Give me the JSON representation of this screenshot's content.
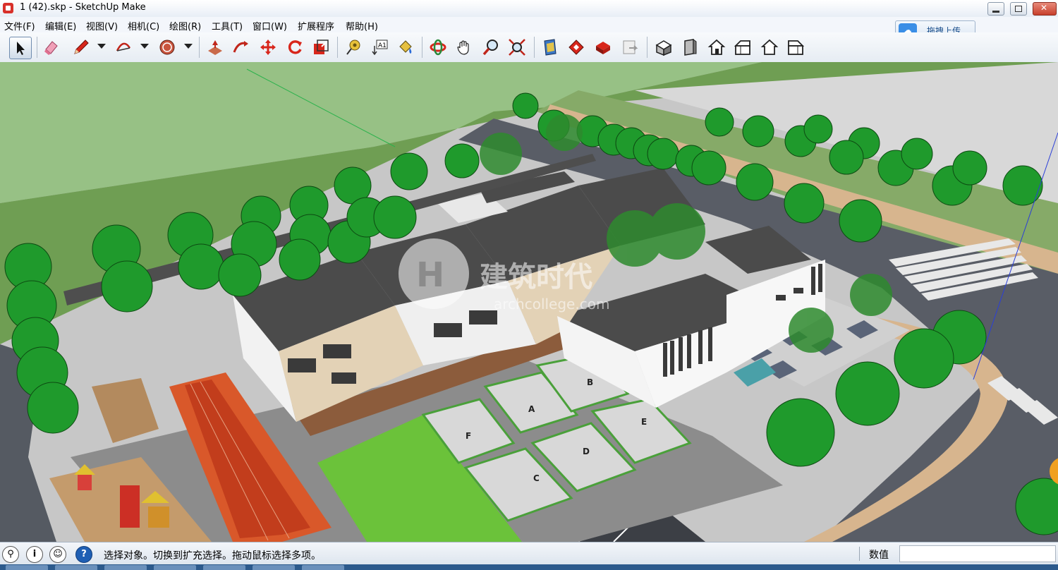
{
  "window": {
    "title": "1 (42).skp - SketchUp Make"
  },
  "menu": {
    "items": [
      "文件(F)",
      "编辑(E)",
      "视图(V)",
      "相机(C)",
      "绘图(R)",
      "工具(T)",
      "窗口(W)",
      "扩展程序",
      "帮助(H)"
    ]
  },
  "upload": {
    "label": "拖拽上传"
  },
  "toolbar": {
    "tools": [
      {
        "name": "select-tool-icon"
      },
      {
        "name": "eraser-tool-icon"
      },
      {
        "name": "pencil-tool-icon"
      },
      {
        "name": "arc-tool-icon"
      },
      {
        "name": "shape-tool-icon"
      },
      {
        "name": "push-pull-tool-icon"
      },
      {
        "name": "follow-me-tool-icon"
      },
      {
        "name": "move-tool-icon"
      },
      {
        "name": "rotate-tool-icon"
      },
      {
        "name": "scale-tool-icon"
      },
      {
        "name": "tape-measure-tool-icon"
      },
      {
        "name": "text-tool-icon"
      },
      {
        "name": "paint-bucket-tool-icon"
      },
      {
        "name": "orbit-tool-icon"
      },
      {
        "name": "pan-tool-icon"
      },
      {
        "name": "zoom-tool-icon"
      },
      {
        "name": "zoom-extents-tool-icon"
      },
      {
        "name": "get-models-icon"
      },
      {
        "name": "share-model-icon"
      },
      {
        "name": "extension-warehouse-icon"
      },
      {
        "name": "send-to-layout-icon"
      },
      {
        "name": "iso-view-icon"
      },
      {
        "name": "top-view-icon"
      },
      {
        "name": "front-view-icon"
      },
      {
        "name": "right-view-icon"
      },
      {
        "name": "back-view-icon"
      },
      {
        "name": "left-view-icon"
      }
    ]
  },
  "viewport": {
    "watermark": "建筑时代",
    "watermark_url": "archcollege.com",
    "plot_labels": [
      "A",
      "B",
      "C",
      "D",
      "E",
      "F"
    ]
  },
  "status": {
    "message": "选择对象。切换到扩充选择。拖动鼠标选择多项。",
    "value_label": "数值",
    "value": ""
  }
}
